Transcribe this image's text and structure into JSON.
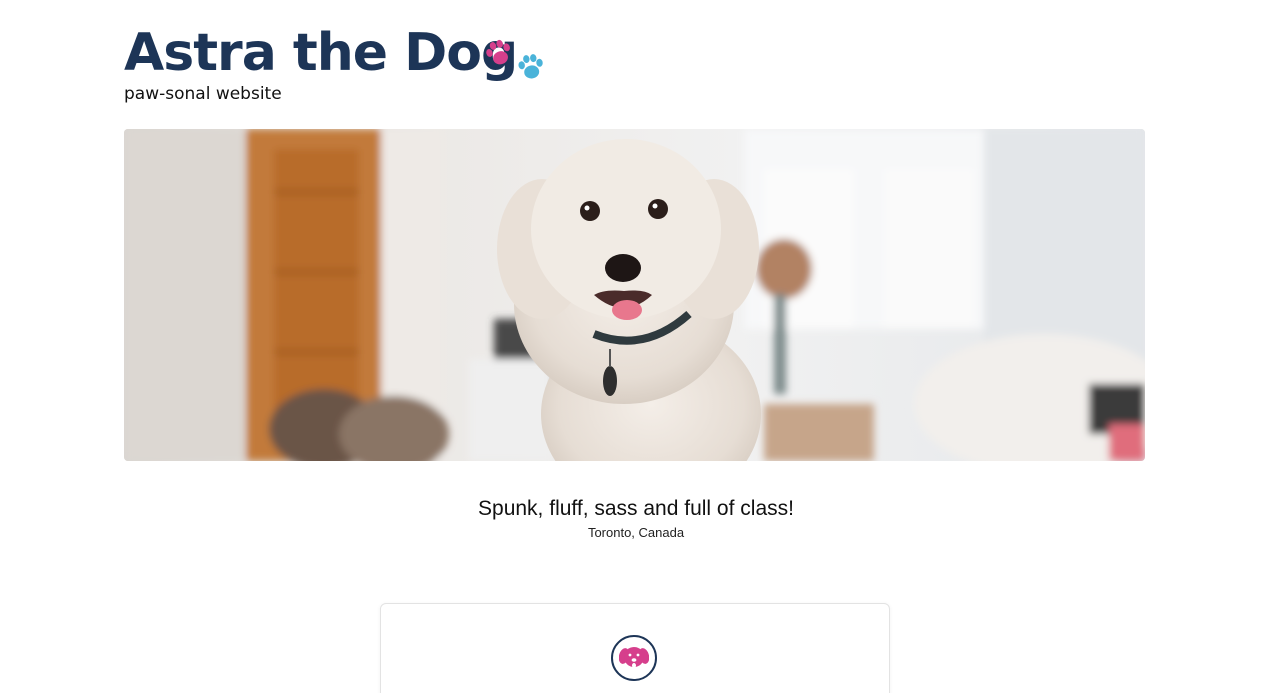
{
  "header": {
    "title": "Astra the Dog",
    "subtitle": "paw-sonal website",
    "paw_icons": [
      "paw-icon-pink",
      "paw-icon-blue"
    ]
  },
  "hero": {
    "image": "dog-photo",
    "alt": "White fluffy dog sitting in a bright living room"
  },
  "intro": {
    "tagline": "Spunk, fluff, sass and full of class!",
    "location": "Toronto, Canada"
  },
  "card": {
    "icon": "dog-face-icon"
  },
  "colors": {
    "title": "#1d3557",
    "paw_pink": "#d63f8c",
    "paw_blue": "#4ab3d9",
    "card_icon_fill": "#d63f8c",
    "card_icon_border": "#1d3557"
  }
}
